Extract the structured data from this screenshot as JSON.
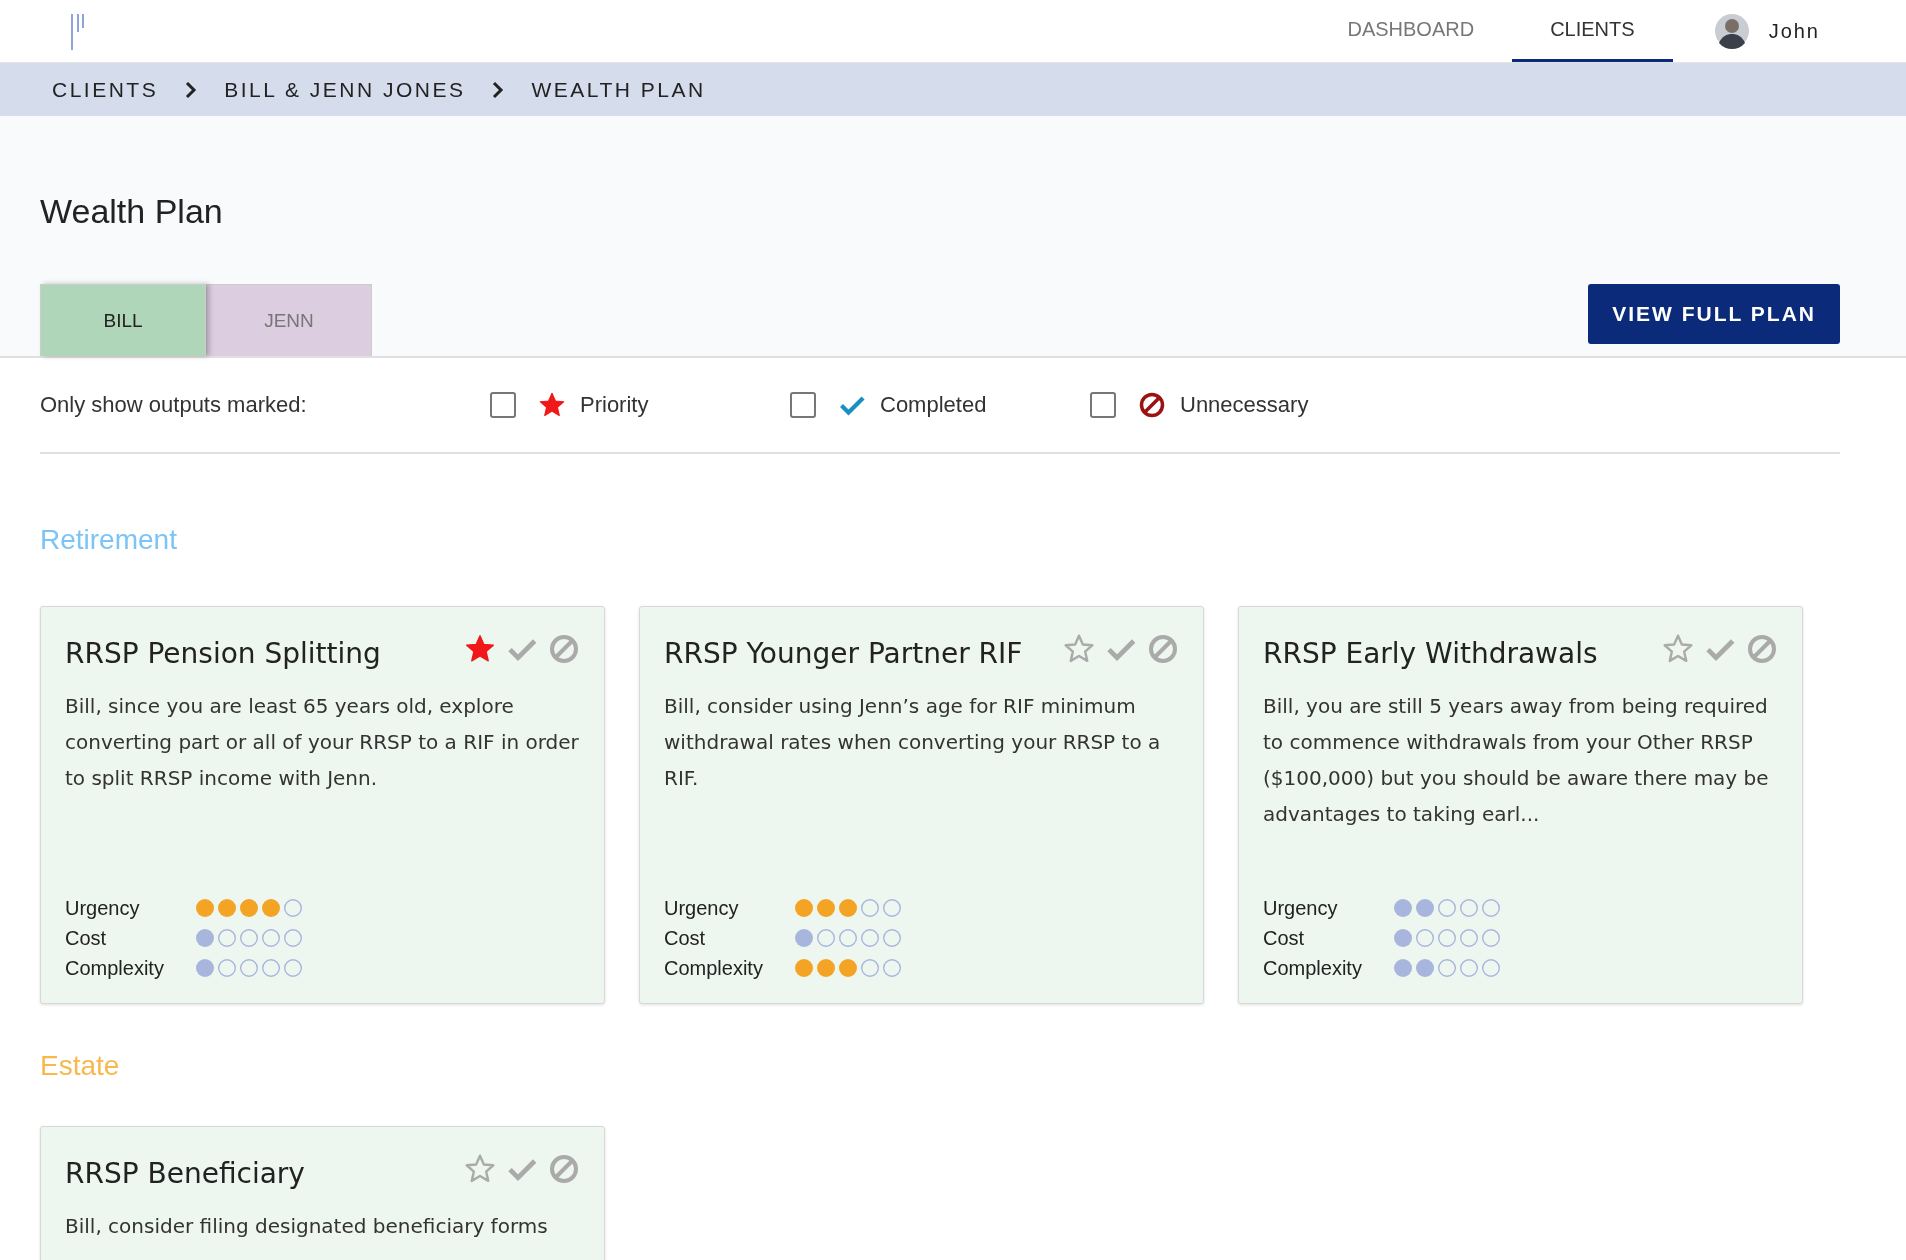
{
  "nav": {
    "items": [
      {
        "label": "DASHBOARD",
        "selected": false
      },
      {
        "label": "CLIENTS",
        "selected": true
      }
    ],
    "user": "John"
  },
  "breadcrumb": [
    "CLIENTS",
    "BILL & JENN JONES",
    "WEALTH PLAN"
  ],
  "title": "Wealth Plan",
  "person_tabs": [
    {
      "label": "BILL",
      "selected": true
    },
    {
      "label": "JENN",
      "selected": false
    }
  ],
  "view_button": "VIEW FULL PLAN",
  "filter": {
    "label": "Only show outputs marked:",
    "options": [
      {
        "kind": "priority",
        "label": "Priority",
        "checked": false
      },
      {
        "kind": "completed",
        "label": "Completed",
        "checked": false
      },
      {
        "kind": "unnecessary",
        "label": "Unnecessary",
        "checked": false
      }
    ]
  },
  "sections": [
    {
      "title": "Retirement",
      "color": "#7cc4f5",
      "cards": [
        {
          "title": "RRSP Pension Splitting",
          "priority": true,
          "completed": false,
          "unnecessary": false,
          "text": "Bill, since you are least 65 years old, explore converting part or all of your RRSP to a RIF in order to split RRSP income with Jenn.",
          "ratings": [
            {
              "label": "Urgency",
              "stars": 4
            },
            {
              "label": "Cost",
              "stars": 1
            },
            {
              "label": "Complexity",
              "stars": 1
            }
          ]
        },
        {
          "title": "RRSP Younger Partner RIF",
          "priority": false,
          "completed": false,
          "unnecessary": false,
          "text": "Bill, consider using Jenn’s age for RIF minimum withdrawal rates when converting your RRSP to a RIF.",
          "ratings": [
            {
              "label": "Urgency",
              "stars": 3
            },
            {
              "label": "Cost",
              "stars": 1
            },
            {
              "label": "Complexity",
              "stars": 3
            }
          ]
        },
        {
          "title": "RRSP Early Withdrawals",
          "priority": false,
          "completed": false,
          "unnecessary": false,
          "text": "Bill, you are still 5 years away from being required to commence withdrawals from your Other RRSP ($100,000) but you should be aware there may be advantages to taking earl...",
          "ratings": [
            {
              "label": "Urgency",
              "stars": 2
            },
            {
              "label": "Cost",
              "stars": 1
            },
            {
              "label": "Complexity",
              "stars": 2
            }
          ]
        }
      ]
    },
    {
      "title": "Estate",
      "color": "#f8b84e",
      "cards": [
        {
          "title": "RRSP Beneficiary",
          "priority": false,
          "completed": false,
          "unnecessary": false,
          "text": "Bill, consider filing designated beneficiary forms"
        }
      ]
    }
  ]
}
